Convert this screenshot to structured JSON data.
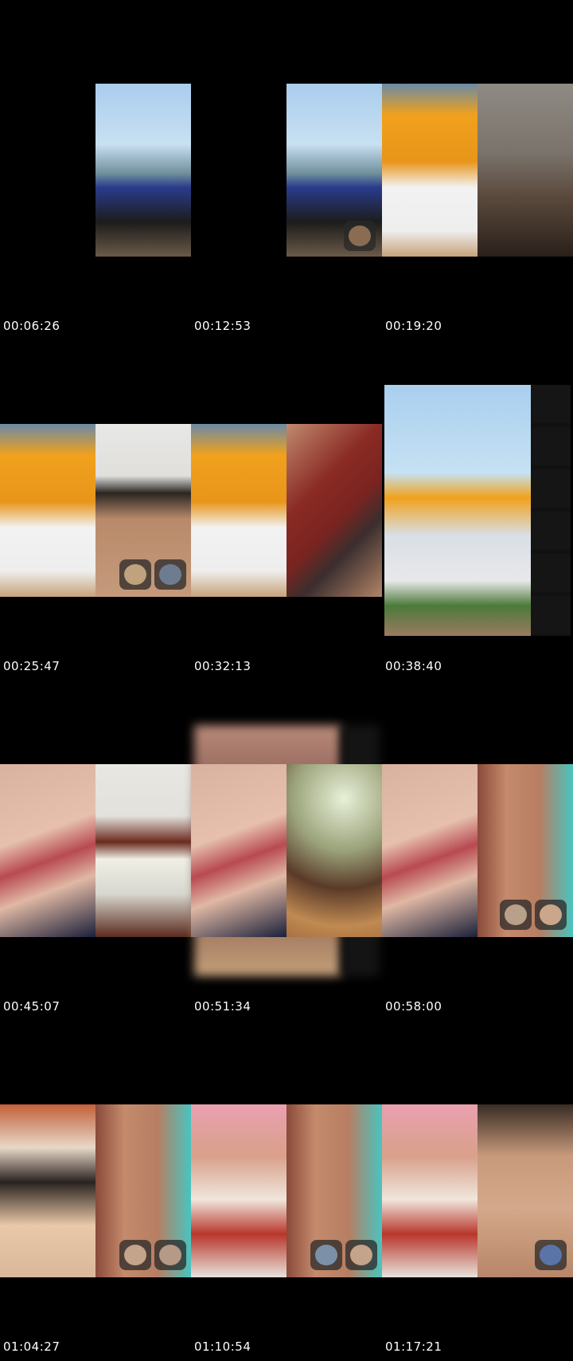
{
  "contact_sheet": {
    "thumbnails": [
      {
        "timestamp": "00:06:26"
      },
      {
        "timestamp": "00:12:53"
      },
      {
        "timestamp": "00:19:20"
      },
      {
        "timestamp": "00:25:47"
      },
      {
        "timestamp": "00:32:13"
      },
      {
        "timestamp": "00:38:40"
      },
      {
        "timestamp": "00:45:07"
      },
      {
        "timestamp": "00:51:34"
      },
      {
        "timestamp": "00:58:00"
      },
      {
        "timestamp": "01:04:27"
      },
      {
        "timestamp": "01:10:54"
      },
      {
        "timestamp": "01:17:21"
      }
    ]
  },
  "palette": {
    "background": "#000000",
    "sky": "#9ec3e3",
    "flowers": "#f0a11c",
    "wall_teal": "#49c4c0",
    "wall_pink": "#e9a0b0"
  }
}
